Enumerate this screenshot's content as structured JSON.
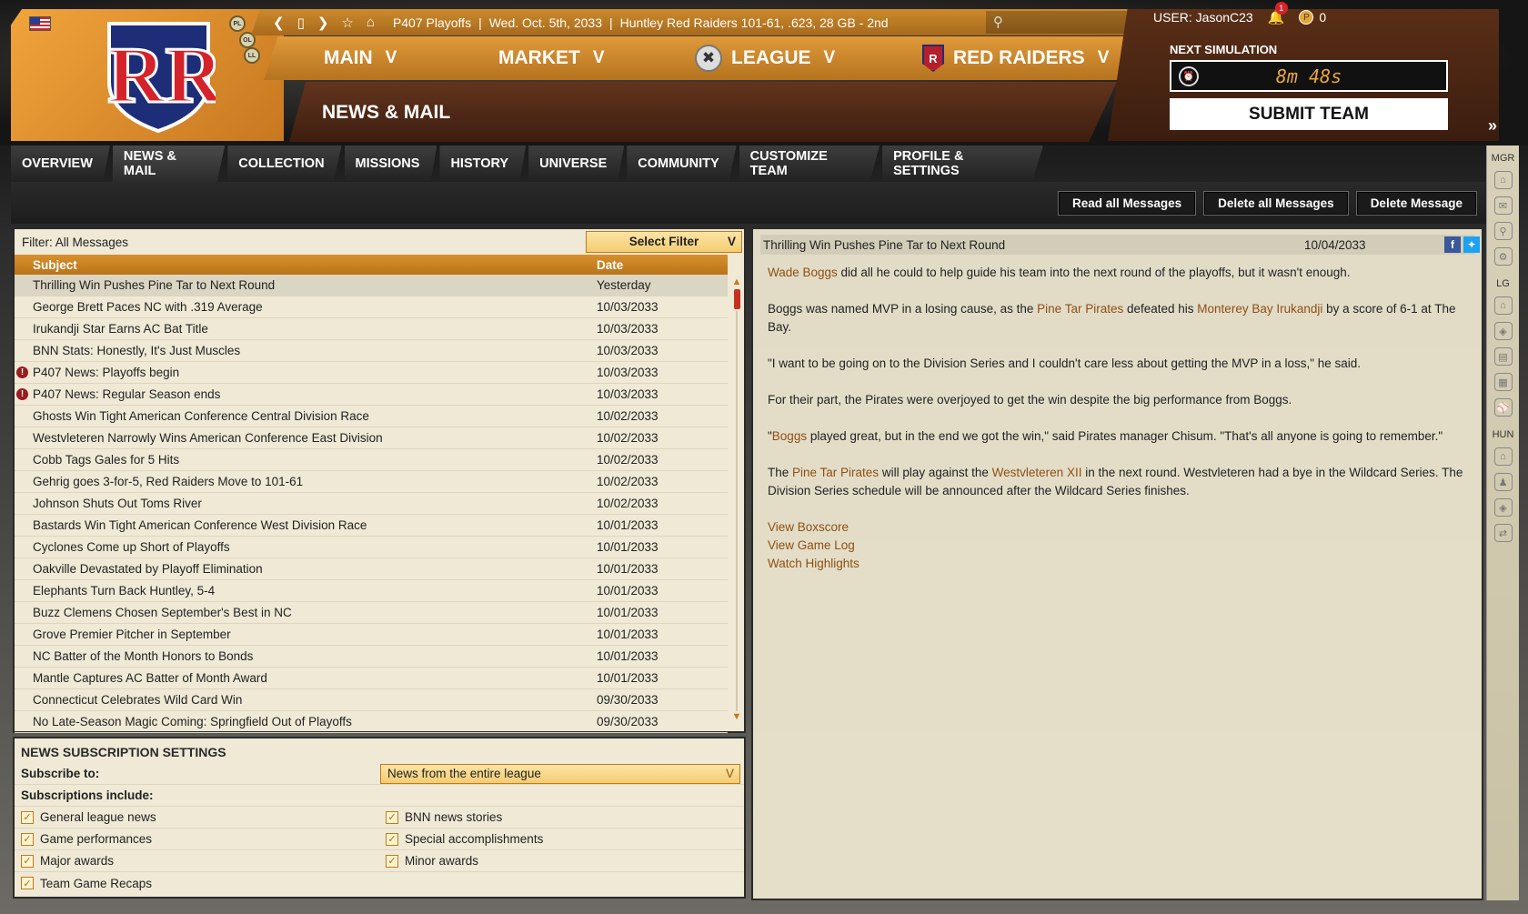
{
  "header": {
    "breadcrumb": "P407 Playoffs",
    "date": "Wed. Oct. 5th, 2033",
    "team_record": "Huntley Red Raiders  101-61, .623, 28 GB - 2nd",
    "logo_letters": "RR",
    "badges": [
      "PL",
      "OL",
      "LL"
    ],
    "menu": {
      "main": "MAIN",
      "market": "MARKET",
      "league": "LEAGUE",
      "team": "RED RAIDERS"
    },
    "page_title": "NEWS & MAIL"
  },
  "user": {
    "label": "USER: JasonC23",
    "notifications": "1",
    "coins": "0",
    "next_sim_label": "NEXT SIMULATION",
    "timer": "8m 48s",
    "submit_label": "SUBMIT TEAM"
  },
  "tabs": [
    {
      "label": "OVERVIEW"
    },
    {
      "label": "NEWS & MAIL"
    },
    {
      "label": "COLLECTION"
    },
    {
      "label": "MISSIONS"
    },
    {
      "label": "HISTORY"
    },
    {
      "label": "UNIVERSE"
    },
    {
      "label": "COMMUNITY"
    },
    {
      "label": "CUSTOMIZE TEAM"
    },
    {
      "label": "PROFILE & SETTINGS"
    }
  ],
  "actions": {
    "read_all": "Read all Messages",
    "delete_all": "Delete all Messages",
    "delete": "Delete Message"
  },
  "sidebar": {
    "mgr": "MGR",
    "lg": "LG",
    "hun": "HUN"
  },
  "messages": {
    "filter_label": "Filter: All Messages",
    "select_filter": "Select Filter",
    "col_subject": "Subject",
    "col_date": "Date",
    "rows": [
      {
        "subject": "Thrilling Win Pushes Pine Tar to Next Round",
        "date": "Yesterday"
      },
      {
        "subject": "George Brett Paces NC with .319 Average",
        "date": "10/03/2033"
      },
      {
        "subject": "Irukandji Star Earns AC Bat Title",
        "date": "10/03/2033"
      },
      {
        "subject": "BNN Stats: Honestly, It's Just Muscles",
        "date": "10/03/2033"
      },
      {
        "subject": "P407 News: Playoffs begin",
        "date": "10/03/2033"
      },
      {
        "subject": "P407 News: Regular Season ends",
        "date": "10/03/2033"
      },
      {
        "subject": "Ghosts Win Tight American Conference Central Division Race",
        "date": "10/02/2033"
      },
      {
        "subject": "Westvleteren Narrowly Wins American Conference East Division",
        "date": "10/02/2033"
      },
      {
        "subject": "Cobb Tags Gales for 5 Hits",
        "date": "10/02/2033"
      },
      {
        "subject": "Gehrig goes 3-for-5, Red Raiders Move to 101-61",
        "date": "10/02/2033"
      },
      {
        "subject": "Johnson Shuts Out Toms River",
        "date": "10/02/2033"
      },
      {
        "subject": "Bastards Win Tight American Conference West Division Race",
        "date": "10/01/2033"
      },
      {
        "subject": "Cyclones Come up Short of Playoffs",
        "date": "10/01/2033"
      },
      {
        "subject": "Oakville Devastated by Playoff Elimination",
        "date": "10/01/2033"
      },
      {
        "subject": "Elephants Turn Back Huntley, 5-4",
        "date": "10/01/2033"
      },
      {
        "subject": "Buzz Clemens Chosen September's Best in NC",
        "date": "10/01/2033"
      },
      {
        "subject": "Grove Premier Pitcher in September",
        "date": "10/01/2033"
      },
      {
        "subject": "NC Batter of the Month Honors to Bonds",
        "date": "10/01/2033"
      },
      {
        "subject": "Mantle Captures AC Batter of Month Award",
        "date": "10/01/2033"
      },
      {
        "subject": "Connecticut Celebrates Wild Card Win",
        "date": "09/30/2033"
      },
      {
        "subject": "No Late-Season Magic Coming: Springfield Out of Playoffs",
        "date": "09/30/2033"
      }
    ]
  },
  "subscription": {
    "title": "NEWS SUBSCRIPTION SETTINGS",
    "subscribe_label": "Subscribe to:",
    "subscribe_value": "News from the entire league",
    "includes_label": "Subscriptions include:",
    "options": [
      "General league news",
      "BNN news stories",
      "Game performances",
      "Special accomplishments",
      "Major awards",
      "Minor awards",
      "Team Game Recaps"
    ]
  },
  "article": {
    "title": "Thrilling Win Pushes Pine Tar to Next Round",
    "date": "10/04/2033",
    "p1_link": "Wade Boggs",
    "p1_rest": " did all he could to help guide his team into the next round of the playoffs, but it wasn't enough.",
    "p2_a": "Boggs was named MVP in a losing cause, as the ",
    "p2_link1": "Pine Tar Pirates",
    "p2_b": " defeated his ",
    "p2_link2": "Monterey Bay Irukandji",
    "p2_c": " by a score of 6-1 at The Bay.",
    "p3": "\"I want to be going on to the Division Series and I couldn't care less about getting the MVP in a loss,\" he said.",
    "p4": "For their part, the Pirates were overjoyed to get the win despite the big performance from Boggs.",
    "p5_q": "\"",
    "p5_link": "Boggs",
    "p5_rest": " played great, but in the end we got the win,\" said Pirates manager   Chisum. \"That's all anyone is going to remember.\"",
    "p6_a": "The ",
    "p6_link1": "Pine Tar Pirates",
    "p6_b": " will play against the ",
    "p6_link2": "Westvleteren XII",
    "p6_c": " in the next round. Westvleteren had a bye in the Wildcard Series. The Division Series schedule will be announced after the Wildcard Series finishes.",
    "links": [
      "View Boxscore",
      "View Game Log",
      "Watch Highlights"
    ]
  }
}
